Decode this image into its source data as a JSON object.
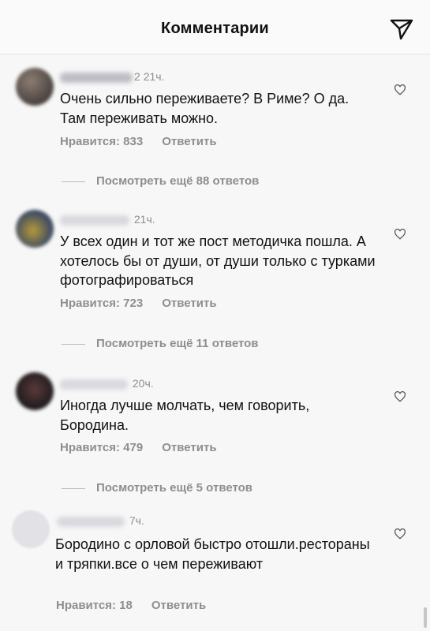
{
  "header": {
    "title": "Комментарии"
  },
  "comments": [
    {
      "username_suffix": "2",
      "time": "21ч.",
      "text": "Очень сильно переживаете? В Риме? О да. Там переживать можно.",
      "likes_label": "Нравится: 833",
      "reply_label": "Ответить",
      "view_replies": "Посмотреть ещё 88 ответов"
    },
    {
      "username_suffix": "",
      "time": "21ч.",
      "text": "У всех один и тот же пост методичка пошла. А хотелось бы от души, от души только с турками фотографироваться",
      "likes_label": "Нравится: 723",
      "reply_label": "Ответить",
      "view_replies": "Посмотреть ещё 11 ответов"
    },
    {
      "username_suffix": "",
      "time": "20ч.",
      "text": "Иногда лучше молчать, чем говорить, Бородина.",
      "likes_label": "Нравится: 479",
      "reply_label": "Ответить",
      "view_replies": "Посмотреть ещё 5 ответов"
    },
    {
      "username_suffix": "",
      "time": "7ч.",
      "text": "Бородино с орловой быстро отошли.рестораны и тряпки.все о чем переживают",
      "likes_label": "Нравится: 18",
      "reply_label": "Ответить"
    }
  ],
  "colors": {
    "text": "#111111",
    "secondary": "#8e8e8e",
    "background": "#f7f7f7"
  },
  "icons": {
    "send": "paper-plane-icon",
    "like": "heart-outline-icon"
  }
}
